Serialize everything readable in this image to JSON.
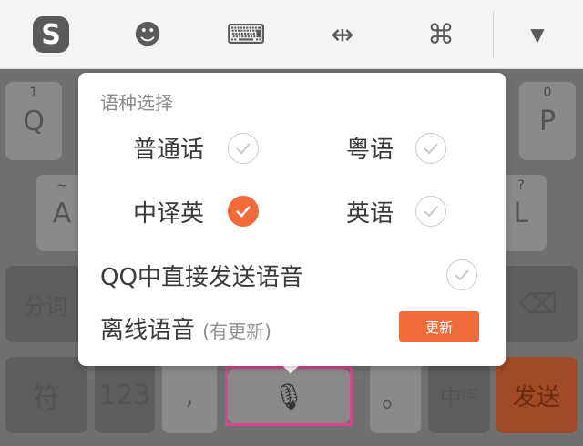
{
  "toolbar": {
    "logo_letter": "S",
    "emoji_glyph": "☻",
    "keyboard_glyph": "⌨",
    "cursor_glyph": "⇹",
    "command_glyph": "⌘",
    "dropdown_glyph": "▼"
  },
  "keyboard": {
    "row1_left": {
      "sup": "1",
      "label": "Q"
    },
    "row1_right": {
      "sup": "0",
      "label": "P"
    },
    "row2_left": {
      "sup": "~",
      "label": "A"
    },
    "row2_right": {
      "sup": "?",
      "label": "L"
    },
    "fenci": "分词",
    "backspace_glyph": "⌫",
    "fu": "符",
    "num": "123",
    "comma": ",",
    "period": "。",
    "zh_main": "中",
    "zh_sub": "/英",
    "send": "发送",
    "mic_glyph": "🎙"
  },
  "popup": {
    "title": "语种选择",
    "options": [
      {
        "label": "普通话",
        "checked": false
      },
      {
        "label": "粤语",
        "checked": false
      },
      {
        "label": "中译英",
        "checked": true
      },
      {
        "label": "英语",
        "checked": false
      }
    ],
    "qq_direct": {
      "label": "QQ中直接发送语音",
      "checked": false
    },
    "offline": {
      "label": "离线语音",
      "hint": "(有更新)",
      "button": "更新"
    }
  },
  "colors": {
    "accent": "#f06b3a",
    "highlight_frame": "#d9468a"
  }
}
